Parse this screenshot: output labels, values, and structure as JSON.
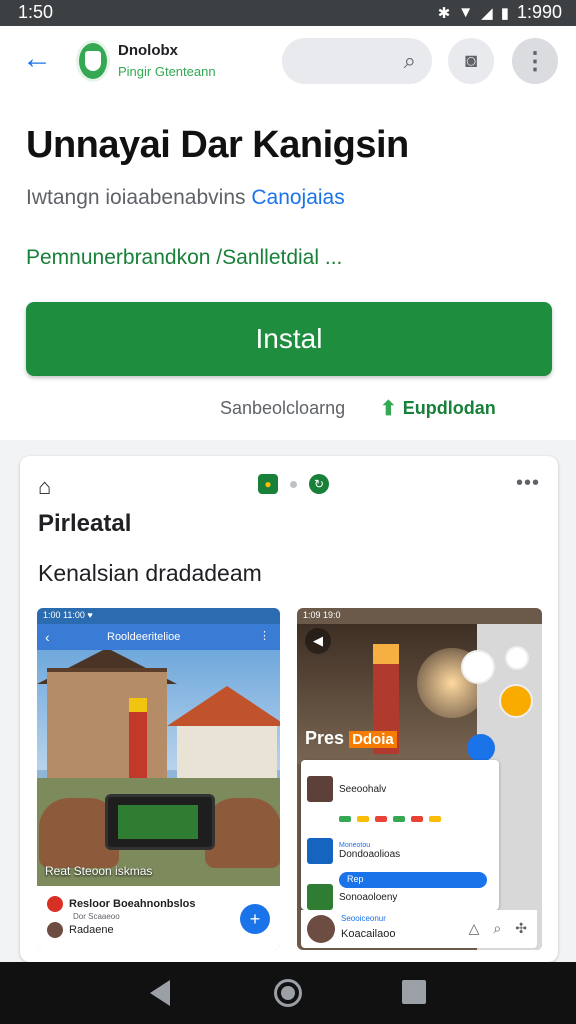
{
  "status_bar": {
    "time": "1:50",
    "right_time": "1:990"
  },
  "app_bar": {
    "developer_name": "Dnolobx",
    "developer_subtitle": "Pingir Gtenteann"
  },
  "app": {
    "title": "Unnayai Dar Kanigsin",
    "subtitle_text": "Iwtangn ioiaabenabvins",
    "subtitle_link": "Canojaias",
    "green_line": "Pemnunerbrandkon /Sanlletdial ...",
    "install_label": "Instal",
    "meta_left": "Sanbeolcloarng",
    "meta_right": "Eupdlodan"
  },
  "card": {
    "title": "Pirleatal",
    "description": "Kenalsian dradadeam"
  },
  "screenshot1": {
    "status": "1:00 11:00 ♥",
    "header_title": "Rooldeeritelioe",
    "caption": "Reat Steoon iskmas",
    "row1_title": "Resloor Boeahnonbslos",
    "row1_sub": "Dor Scaaeoo",
    "row2_title": "Radaene",
    "fab_label": "+"
  },
  "screenshot2": {
    "status": "1:09 19:0",
    "overlay_text": "Pres",
    "overlay_highlight": "Ddoia",
    "panel_row1": "Seeoohalv",
    "panel_row2_top": "Moneotou",
    "panel_row2": "Dondoaolioas",
    "panel_row3": "Rep",
    "panel_row4": "Sonoaoloeny",
    "bottom_top": "Seooiceonur",
    "bottom_title": "Koacailaoo"
  },
  "colors": {
    "accent_green": "#1e8e3e",
    "link_blue": "#1a73e8",
    "status_bar": "#3c4043"
  }
}
